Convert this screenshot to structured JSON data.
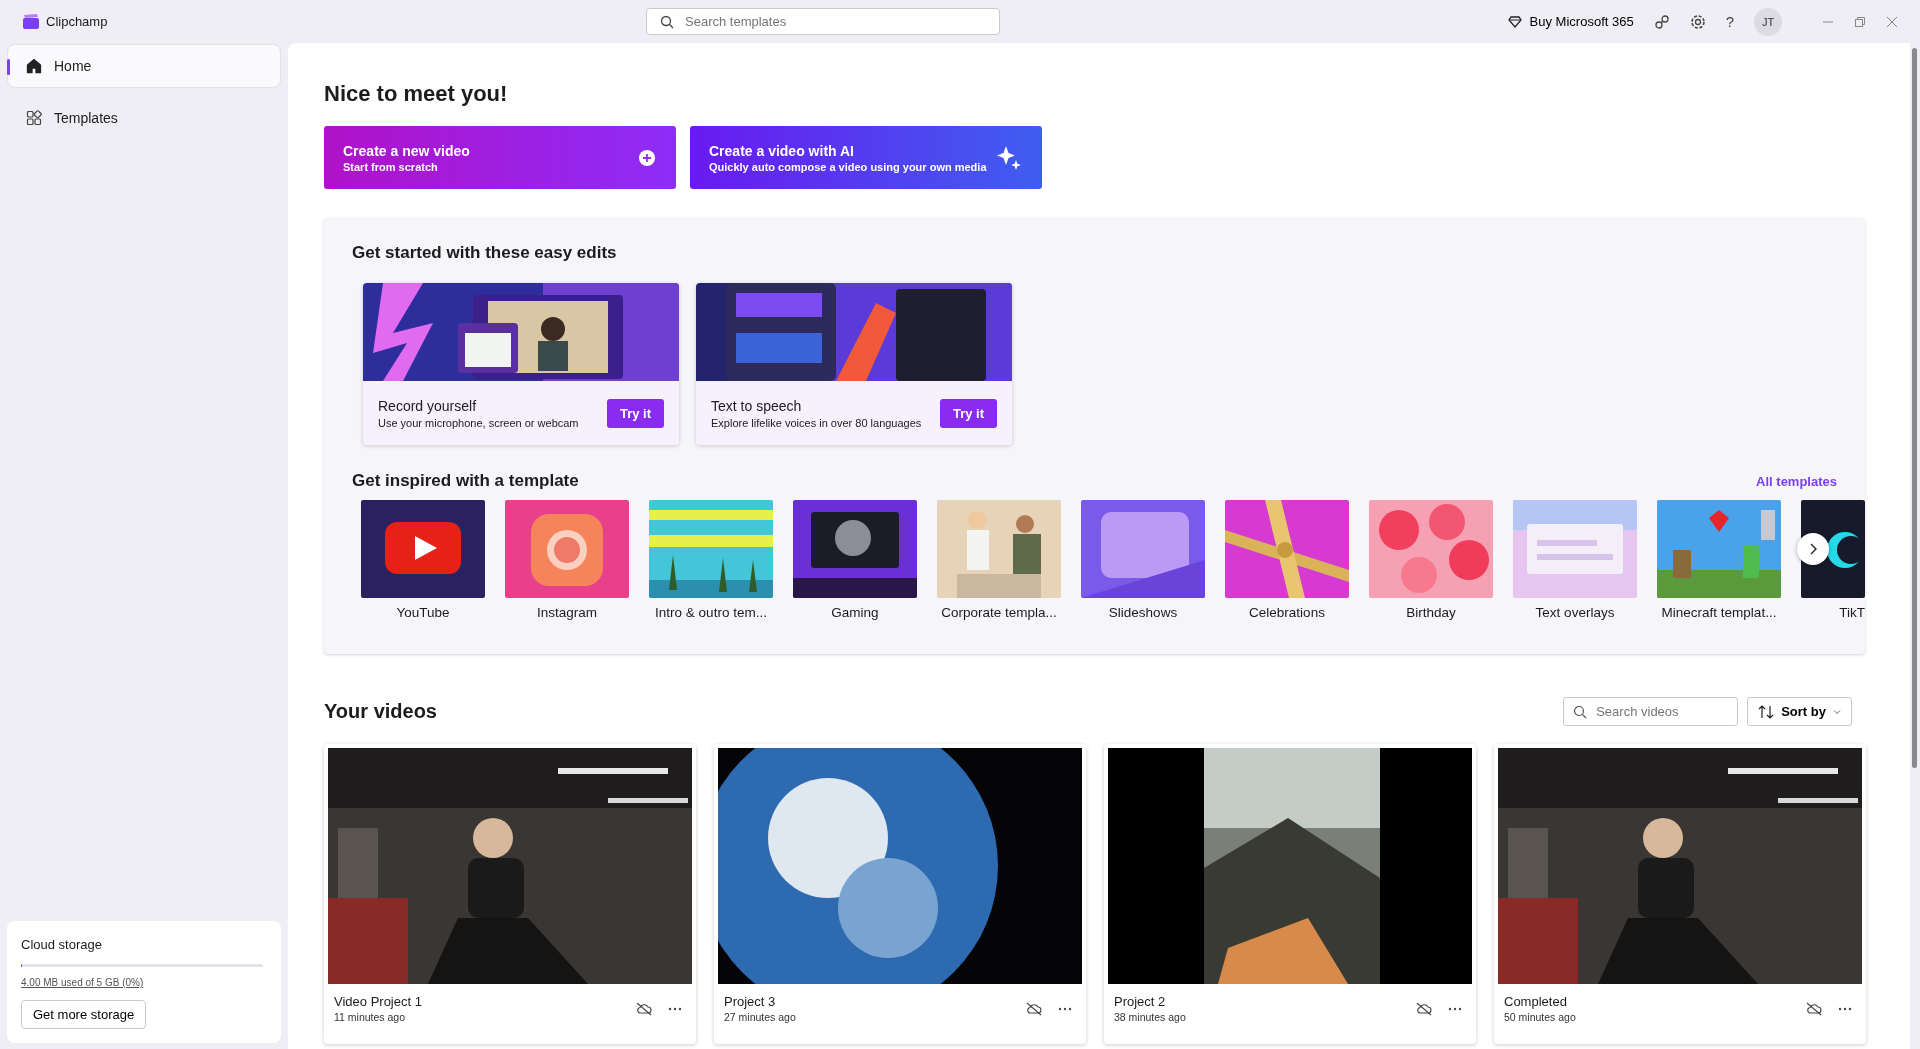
{
  "app": {
    "name": "Clipchamp"
  },
  "search": {
    "placeholder": "Search templates"
  },
  "topbar": {
    "buy": "Buy Microsoft 365",
    "help": "?",
    "avatar": "JT"
  },
  "sidebar": {
    "items": [
      {
        "label": "Home",
        "kind": "home",
        "selected": true
      },
      {
        "label": "Templates",
        "kind": "templates",
        "selected": false
      }
    ],
    "storage": {
      "title": "Cloud storage",
      "level": 0.001,
      "usage": "4.00 MB used of 5 GB (0%)",
      "button": "Get more storage"
    }
  },
  "greeting": "Nice to meet you!",
  "create_buttons": [
    {
      "kind": "new",
      "title": "Create a new video",
      "subtitle": "Start from scratch"
    },
    {
      "kind": "ai",
      "title": "Create a video with AI",
      "subtitle": "Quickly auto compose a video using your own media"
    }
  ],
  "easy_edits": {
    "title": "Get started with these easy edits",
    "cards": [
      {
        "title": "Record yourself",
        "subtitle": "Use your microphone, screen or webcam",
        "button": "Try it"
      },
      {
        "title": "Text to speech",
        "subtitle": "Explore lifelike voices in over 80 languages",
        "button": "Try it"
      }
    ]
  },
  "templates": {
    "title": "Get inspired with a template",
    "link": "All templates",
    "items": [
      {
        "label": "YouTube"
      },
      {
        "label": "Instagram"
      },
      {
        "label": "Intro & outro tem..."
      },
      {
        "label": "Gaming"
      },
      {
        "label": "Corporate templa..."
      },
      {
        "label": "Slideshows"
      },
      {
        "label": "Celebrations"
      },
      {
        "label": "Birthday"
      },
      {
        "label": "Text overlays"
      },
      {
        "label": "Minecraft templat..."
      },
      {
        "label": "TikT"
      }
    ]
  },
  "videos": {
    "title": "Your videos",
    "search_placeholder": "Search videos",
    "sort": "Sort by",
    "items": [
      {
        "title": "Video Project 1",
        "time": "11 minutes ago"
      },
      {
        "title": "Project 3",
        "time": "27 minutes ago"
      },
      {
        "title": "Project 2",
        "time": "38 minutes ago"
      },
      {
        "title": "Completed",
        "time": "50 minutes ago"
      }
    ]
  }
}
